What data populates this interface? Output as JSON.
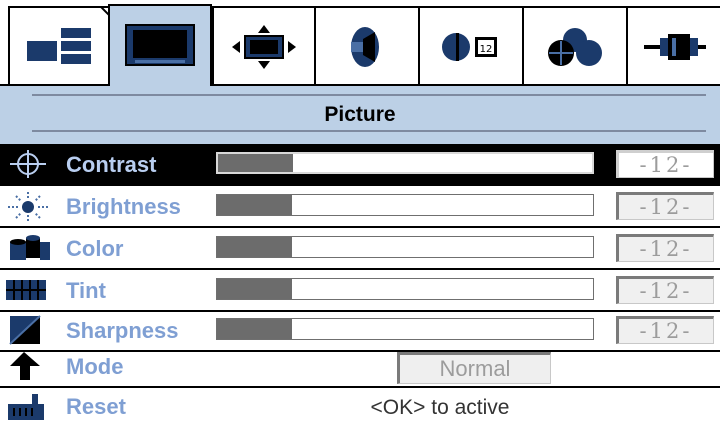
{
  "menu": {
    "tabs": [
      {
        "icon": "layout-icon",
        "selected": false
      },
      {
        "icon": "monitor-icon",
        "selected": true
      },
      {
        "icon": "position-icon",
        "selected": false
      },
      {
        "icon": "speaker-icon",
        "selected": false
      },
      {
        "icon": "pip-icon",
        "selected": false
      },
      {
        "icon": "color-circles-icon",
        "selected": false
      },
      {
        "icon": "connector-icon",
        "selected": false
      }
    ],
    "title": "Picture"
  },
  "rows": [
    {
      "label": "Contrast",
      "icon": "crosshair-icon",
      "level": 0.2,
      "value": "-12-",
      "selected": true
    },
    {
      "label": "Brightness",
      "icon": "sun-icon",
      "level": 0.2,
      "value": "-12-",
      "selected": false
    },
    {
      "label": "Color",
      "icon": "paint-cans-icon",
      "level": 0.2,
      "value": "-12-",
      "selected": false
    },
    {
      "label": "Tint",
      "icon": "tint-grid-icon",
      "level": 0.2,
      "value": "-12-",
      "selected": false
    },
    {
      "label": "Sharpness",
      "icon": "sharpness-icon",
      "level": 0.2,
      "value": "-12-",
      "selected": false
    }
  ],
  "mode": {
    "label": "Mode",
    "icon": "arrow-up-icon",
    "value": "Normal"
  },
  "reset": {
    "label": "Reset",
    "icon": "factory-icon",
    "hint": "<OK> to active"
  },
  "colors": {
    "accent_text": "#7f9fd3",
    "header_bg": "#bcd0e6",
    "bar_fill": "#6c6c6c"
  }
}
